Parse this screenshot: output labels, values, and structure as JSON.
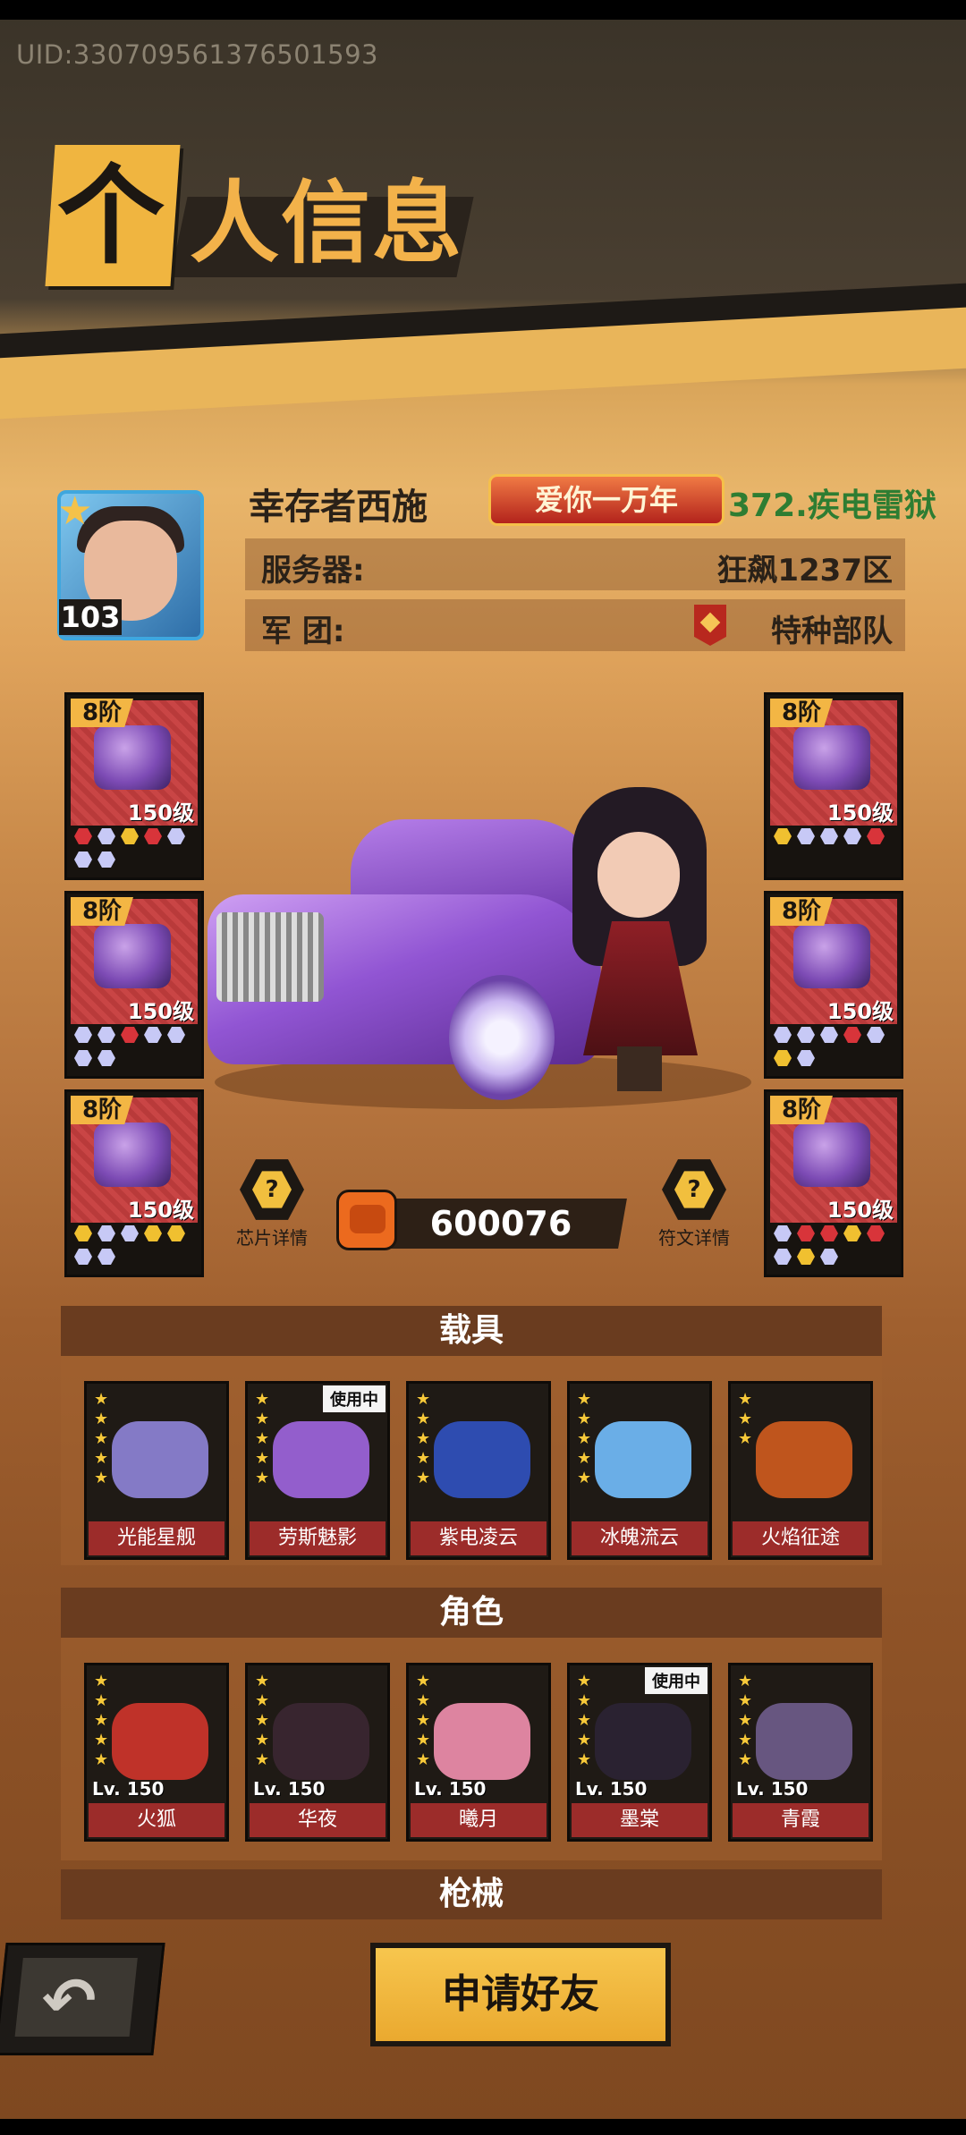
{
  "uid": "UID:330709561376501593",
  "title": {
    "first_char": "个",
    "rest": "人信息"
  },
  "player": {
    "name": "幸存者西施",
    "level": "103",
    "badge": "爱你一万年",
    "server_tag": "372.疾电雷狱"
  },
  "info": {
    "server_label": "服务器:",
    "server_value": "狂飙1237区",
    "legion_label": "军    团:",
    "legion_value": "特种部队"
  },
  "equipment": {
    "left": [
      {
        "tier": "8阶",
        "level": "150级"
      },
      {
        "tier": "8阶",
        "level": "150级"
      },
      {
        "tier": "8阶",
        "level": "150级"
      }
    ],
    "right": [
      {
        "tier": "8阶",
        "level": "150级"
      },
      {
        "tier": "8阶",
        "level": "150级"
      },
      {
        "tier": "8阶",
        "level": "150级"
      }
    ]
  },
  "buttons": {
    "chip_detail": "芯片详情",
    "rune_detail": "符文详情",
    "apply_friend": "申请好友"
  },
  "power": "600076",
  "sections": {
    "vehicles": "载具",
    "roles": "角色",
    "weapons": "枪械"
  },
  "vehicles": [
    {
      "name": "光能星舰",
      "in_use": ""
    },
    {
      "name": "劳斯魅影",
      "in_use": "使用中"
    },
    {
      "name": "紫电凌云",
      "in_use": ""
    },
    {
      "name": "冰魄流云",
      "in_use": ""
    },
    {
      "name": "火焰征途",
      "in_use": ""
    }
  ],
  "roles": [
    {
      "name": "火狐",
      "level": "Lv. 150",
      "in_use": ""
    },
    {
      "name": "华夜",
      "level": "Lv. 150",
      "in_use": ""
    },
    {
      "name": "曦月",
      "level": "Lv. 150",
      "in_use": ""
    },
    {
      "name": "墨棠",
      "level": "Lv. 150",
      "in_use": "使用中"
    },
    {
      "name": "青霞",
      "level": "Lv. 150",
      "in_use": ""
    }
  ]
}
